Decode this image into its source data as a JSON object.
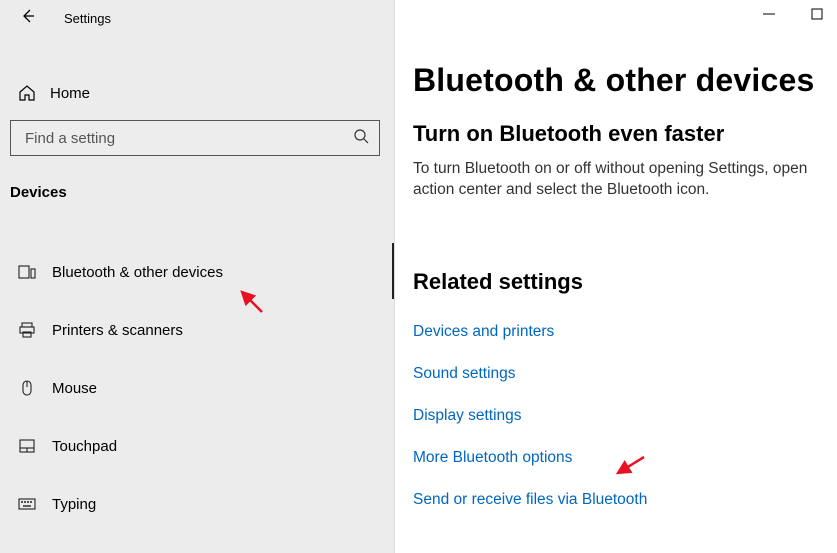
{
  "app_title": "Settings",
  "home_label": "Home",
  "search_placeholder": "Find a setting",
  "section_header": "Devices",
  "nav_items": [
    {
      "id": "bluetooth",
      "label": "Bluetooth & other devices"
    },
    {
      "id": "printers",
      "label": "Printers & scanners"
    },
    {
      "id": "mouse",
      "label": "Mouse"
    },
    {
      "id": "touchpad",
      "label": "Touchpad"
    },
    {
      "id": "typing",
      "label": "Typing"
    }
  ],
  "main": {
    "title": "Bluetooth & other devices",
    "subheading": "Turn on Bluetooth even faster",
    "body": "To turn Bluetooth on or off without opening Settings, open action center and select the Bluetooth icon.",
    "related_heading": "Related settings",
    "links": [
      "Devices and printers",
      "Sound settings",
      "Display settings",
      "More Bluetooth options",
      "Send or receive files via Bluetooth"
    ]
  }
}
